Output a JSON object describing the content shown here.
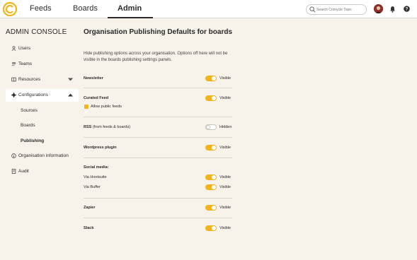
{
  "nav": {
    "tabs": [
      {
        "label": "Feeds",
        "active": false
      },
      {
        "label": "Boards",
        "active": false
      },
      {
        "label": "Admin",
        "active": true
      }
    ],
    "search_placeholder": "Search Cronycle Topic",
    "icons": [
      "cronycle-logo-icon",
      "search-icon",
      "avatar",
      "bell-icon",
      "help-icon"
    ]
  },
  "colors": {
    "accent": "#f0b51d",
    "background": "#f7f2ea",
    "topbar": "#ffffff"
  },
  "sidebar": {
    "title": "ADMIN CONSOLE",
    "items": [
      {
        "label": "Users",
        "icon": "user-icon"
      },
      {
        "label": "Teams",
        "icon": "team-icon"
      },
      {
        "label": "Resources",
        "icon": "book-icon",
        "expand": "chevron-down-icon"
      },
      {
        "label": "Configurations",
        "icon": "gear-icon",
        "expand": "chevron-up-icon",
        "selected": true
      },
      {
        "label": "Organisation information",
        "icon": "info-icon"
      },
      {
        "label": "Audit",
        "icon": "document-icon"
      }
    ],
    "sub_items": [
      {
        "label": "Sources"
      },
      {
        "label": "Boards"
      },
      {
        "label": "Publishing",
        "current": true
      }
    ]
  },
  "main": {
    "title": "Organisation Publishing Defaults for boards",
    "intro": "Hide publishing options across your organisation. Options off here will not be visible in the boards publishing settings panels.",
    "settings": [
      {
        "label": "Newsletter",
        "on": true,
        "state": "Visible"
      },
      {
        "label": "Curated Feed",
        "on": true,
        "state": "Visible"
      },
      {
        "label": "RSS",
        "suffix": " (from feeds & boards)",
        "on": false,
        "state": "Hidden"
      },
      {
        "label": "Wordpress plugin",
        "on": true,
        "state": "Visible"
      },
      {
        "label": "Via Hootsuite",
        "on": true,
        "state": "Visible"
      },
      {
        "label": "Via Buffer",
        "on": true,
        "state": "Visible"
      },
      {
        "label": "Zapier",
        "on": true,
        "state": "Visible"
      },
      {
        "label": "Slack",
        "on": true,
        "state": "Visible"
      }
    ],
    "curated_option": {
      "label": "Allow public feeds",
      "checked": true
    },
    "social_heading": "Social media:"
  }
}
